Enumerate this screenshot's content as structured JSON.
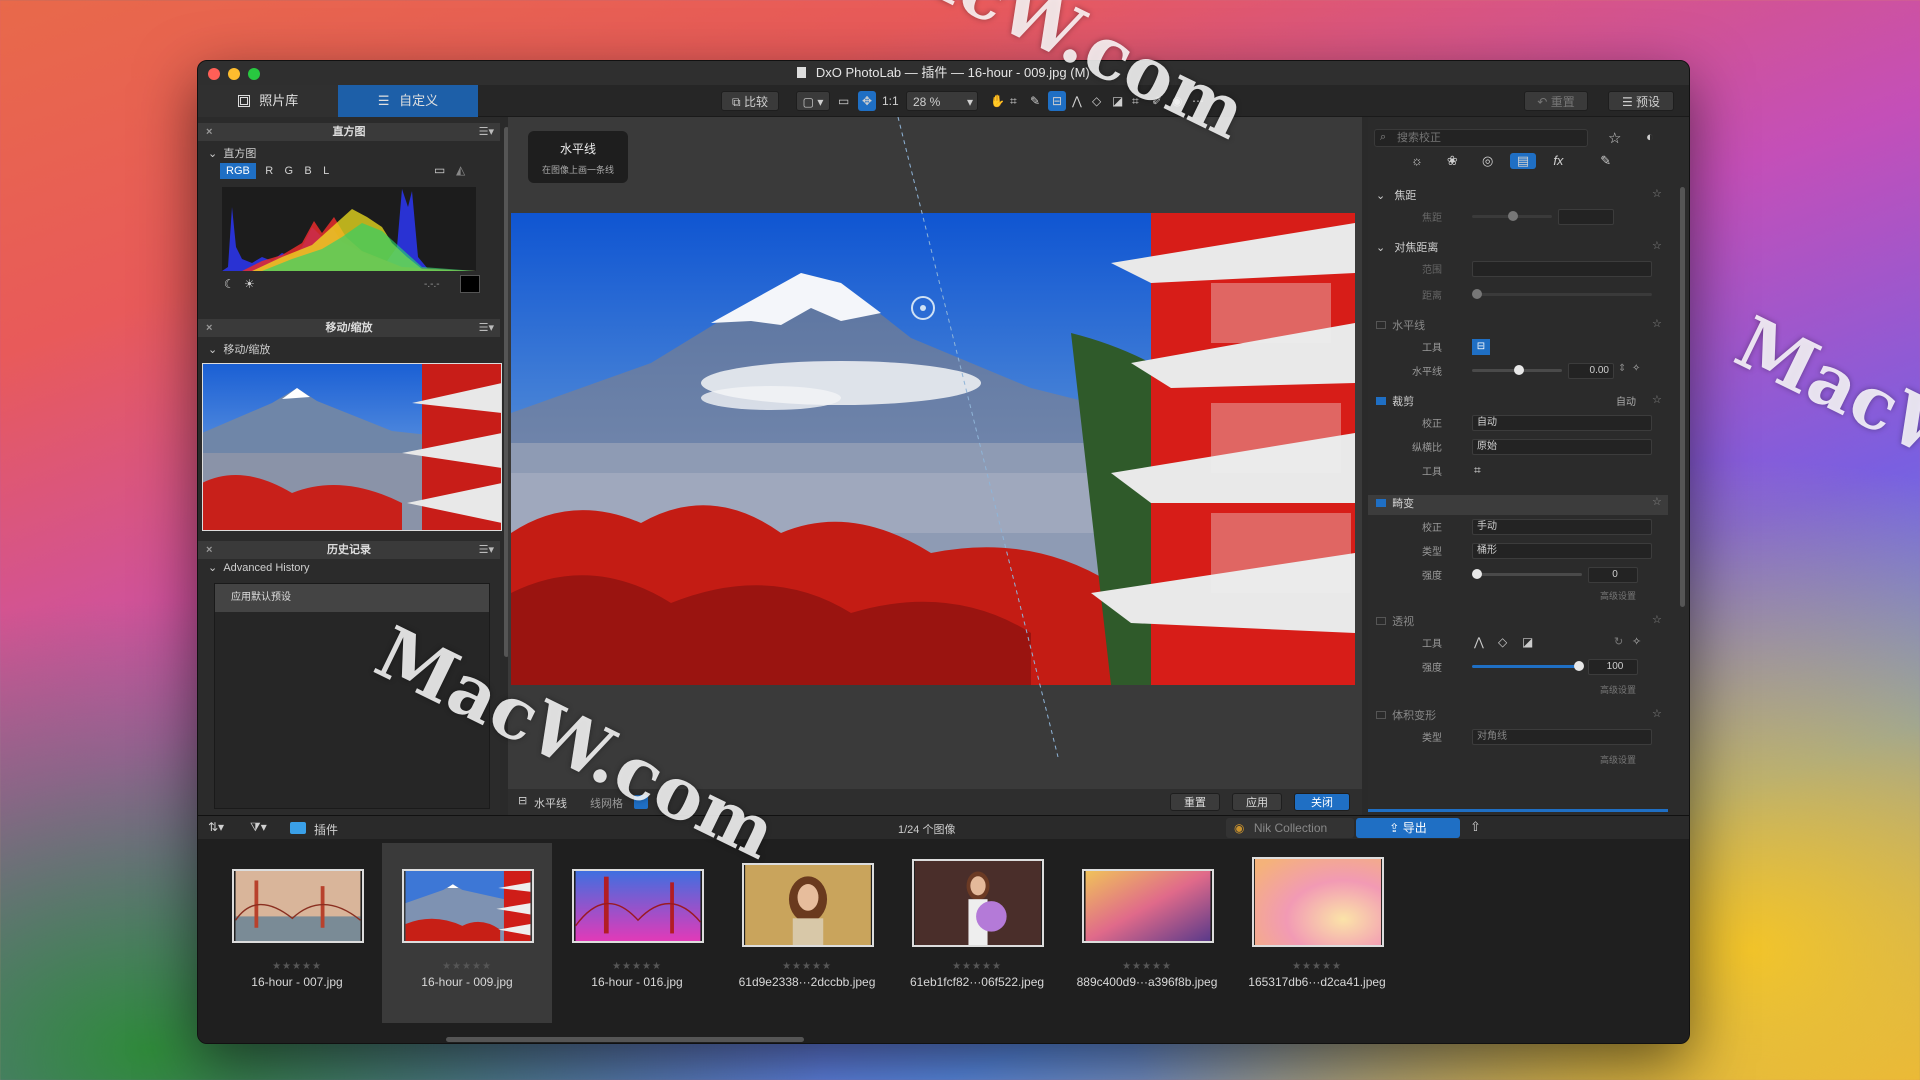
{
  "window": {
    "title": "DxO PhotoLab — 插件 — 16-hour - 009.jpg (M)"
  },
  "toolbar": {
    "tab_library": "照片库",
    "tab_customize": "自定义",
    "compare": "比较",
    "zoom_1to1": "1:1",
    "zoom_level": "28 %",
    "reset": "重置",
    "presets": "预设"
  },
  "left": {
    "histogram_header": "直方图",
    "histogram_sub": "直方图",
    "channels": [
      "RGB",
      "R",
      "G",
      "B",
      "L"
    ],
    "histogram_readout": "-.-.-",
    "navigator_header": "移动/缩放",
    "navigator_sub": "移动/缩放",
    "history_header": "历史记录",
    "history_sub": "Advanced History",
    "history_item": "应用默认预设"
  },
  "center": {
    "tooltip_title": "水平线",
    "tooltip_desc": "在图像上画一条线",
    "footer_tool": "水平线",
    "footer_grid": "线网格",
    "btn_reset": "重置",
    "btn_apply": "应用",
    "btn_close": "关闭"
  },
  "right": {
    "search_placeholder": "搜索校正",
    "focal": {
      "title": "焦距",
      "label": "焦距"
    },
    "focus_distance": {
      "title": "对焦距离",
      "range_label": "范围",
      "distance_label": "距离"
    },
    "horizon": {
      "title": "水平线",
      "tool_label": "工具",
      "value_label": "水平线",
      "value": "0.00"
    },
    "crop": {
      "title": "裁剪",
      "auto": "自动",
      "correct_label": "校正",
      "correct_value": "自动",
      "ratio_label": "纵横比",
      "ratio_value": "原始",
      "tool_label": "工具"
    },
    "distortion": {
      "title": "畸变",
      "correct_label": "校正",
      "correct_value": "手动",
      "type_label": "类型",
      "type_value": "桶形",
      "strength_label": "强度",
      "strength_value": "0",
      "advanced": "高级设置"
    },
    "perspective": {
      "title": "透视",
      "tool_label": "工具",
      "strength_label": "强度",
      "strength_value": "100",
      "advanced": "高级设置"
    },
    "volume": {
      "title": "体积变形",
      "type_label": "类型",
      "type_value": "对角线",
      "advanced": "高级设置"
    }
  },
  "filmstrip": {
    "folder": "插件",
    "count": "1/24 个图像",
    "nik": "Nik Collection",
    "export": "导出",
    "items": [
      {
        "name": "16-hour - 007.jpg",
        "stars": "★★★★★"
      },
      {
        "name": "16-hour - 009.jpg",
        "stars": "★★★★★"
      },
      {
        "name": "16-hour - 016.jpg",
        "stars": "★★★★★"
      },
      {
        "name": "61d9e2338···2dccbb.jpeg",
        "stars": "★★★★★"
      },
      {
        "name": "61eb1fcf82···06f522.jpeg",
        "stars": "★★★★★"
      },
      {
        "name": "889c400d9···a396f8b.jpeg",
        "stars": "★★★★★"
      },
      {
        "name": "165317db6···d2ca41.jpeg",
        "stars": "★★★★★"
      }
    ]
  },
  "watermark": "MacW.com",
  "colors": {
    "accent": "#1f6fc4",
    "selected_tab": "#1d5fa8"
  }
}
